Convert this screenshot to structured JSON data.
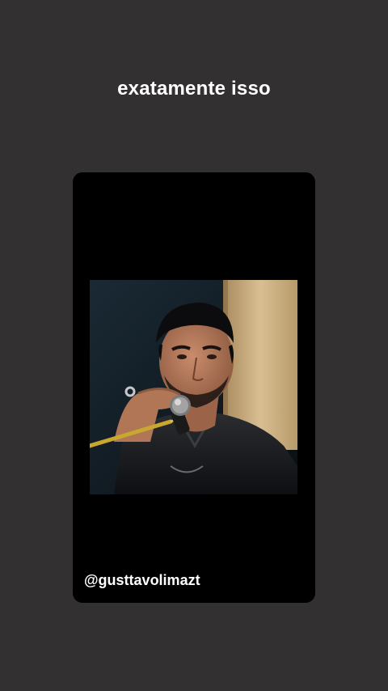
{
  "story": {
    "caption": "exatamente isso",
    "username": "@gusttavolimazt"
  },
  "video": {
    "subject": "singer-at-microphone"
  },
  "colors": {
    "background": "#333031",
    "card": "#000000",
    "text": "#ffffff"
  }
}
